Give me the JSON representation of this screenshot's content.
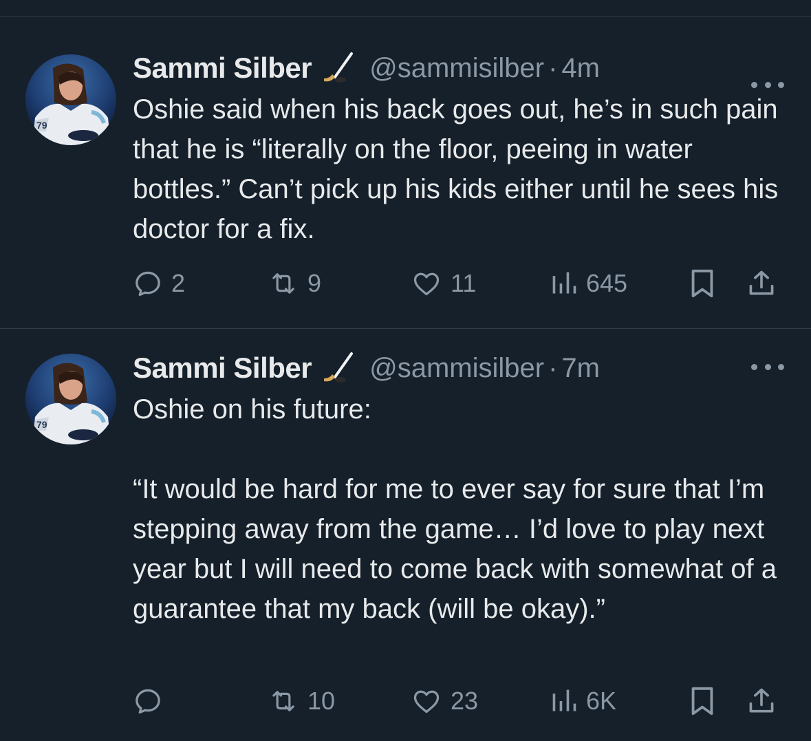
{
  "colors": {
    "background": "#15202b",
    "divider": "#2f3b47",
    "text_primary": "#e7e9ea",
    "text_secondary": "#8b98a5"
  },
  "tweets": [
    {
      "author": {
        "name": "Sammi Silber",
        "name_emoji": "hockey-stick-emoji",
        "handle": "@sammisilber",
        "separator": "·",
        "time": "4m"
      },
      "text": "Oshie said when his back goes out, he’s in such pain that he is “literally on the floor, peeing in water bottles.” Can’t pick up his kids either until he sees his doctor for a fix.",
      "actions": {
        "replies": "2",
        "retweets": "9",
        "likes": "11",
        "views": "645"
      }
    },
    {
      "author": {
        "name": "Sammi Silber",
        "name_emoji": "hockey-stick-emoji",
        "handle": "@sammisilber",
        "separator": "·",
        "time": "7m"
      },
      "text": "Oshie on his future:\n\n“It would be hard for me to ever say for sure that I’m stepping away from the game… I’d love to play next year but I will need to come back with somewhat of a guarantee that my back (will be okay).”",
      "actions": {
        "replies": "",
        "retweets": "10",
        "likes": "23",
        "views": "6K"
      }
    }
  ]
}
